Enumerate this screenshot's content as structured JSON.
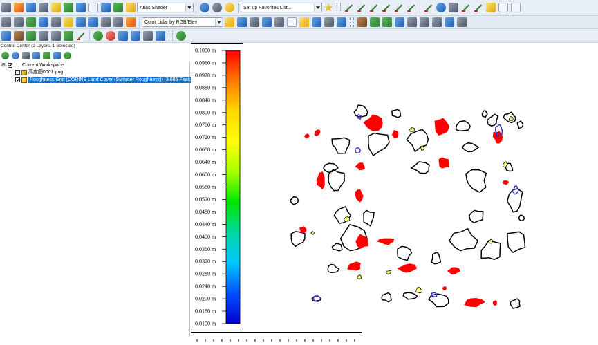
{
  "toolbar": {
    "shader_select": "Atlas Shader",
    "favorites_select": "Set up Favorites List...",
    "lidar_select": "Color Lidar by RGB/Elev"
  },
  "control_center": {
    "title": "Control Center (2 Layers, 1 Selected)",
    "root": "Current Workspace",
    "layers": [
      {
        "name": "高度图0001.png",
        "checked": false,
        "selected": false
      },
      {
        "name": "Roughness Grid (CORINE Land Cover (Summer Roughness)) [3,085 Featu",
        "checked": true,
        "selected": true
      }
    ]
  },
  "legend": {
    "labels": [
      "0.1000 m",
      "0.0960 m",
      "0.0920 m",
      "0.0880 m",
      "0.0840 m",
      "0.0800 m",
      "0.0760 m",
      "0.0720 m",
      "0.0680 m",
      "0.0640 m",
      "0.0600 m",
      "0.0560 m",
      "0.0520 m",
      "0.0480 m",
      "0.0440 m",
      "0.0400 m",
      "0.0360 m",
      "0.0320 m",
      "0.0280 m",
      "0.0240 m",
      "0.0200 m",
      "0.0160 m",
      "0.0100 m"
    ],
    "ramp_colors": [
      "#ff0000",
      "#ff7a00",
      "#ffd800",
      "#ffff00",
      "#a8ff00",
      "#00e600",
      "#00d8a0",
      "#00c8ff",
      "#0050ff",
      "#0000d0"
    ]
  },
  "map_colors": {
    "outline": "#000000",
    "high_roughness_fill": "#ff0000",
    "low_fill_a": "#ffff80",
    "low_fill_b": "#3030d0"
  }
}
